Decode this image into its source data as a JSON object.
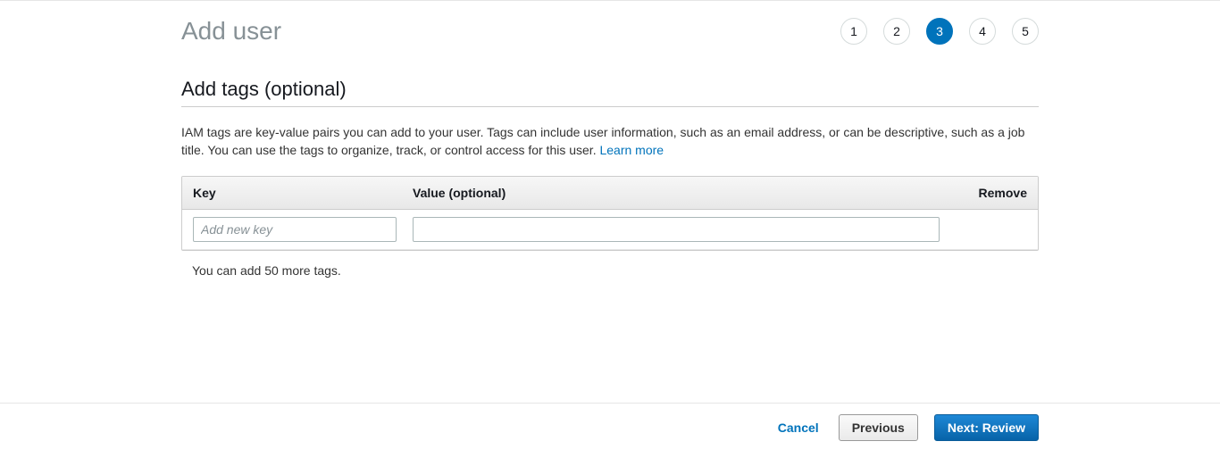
{
  "header": {
    "title": "Add user"
  },
  "stepper": {
    "steps": [
      "1",
      "2",
      "3",
      "4",
      "5"
    ],
    "activeIndex": 2
  },
  "section": {
    "title": "Add tags (optional)",
    "description_part1": "IAM tags are key-value pairs you can add to your user. Tags can include user information, such as an email address, or can be descriptive, such as a job title. You can use the tags to organize, track, or control access for this user. ",
    "learn_more": "Learn more"
  },
  "table": {
    "col_key": "Key",
    "col_value": "Value (optional)",
    "col_remove": "Remove",
    "key_placeholder": "Add new key",
    "value_placeholder": ""
  },
  "hint": "You can add 50 more tags.",
  "footer": {
    "cancel": "Cancel",
    "previous": "Previous",
    "next": "Next: Review"
  }
}
